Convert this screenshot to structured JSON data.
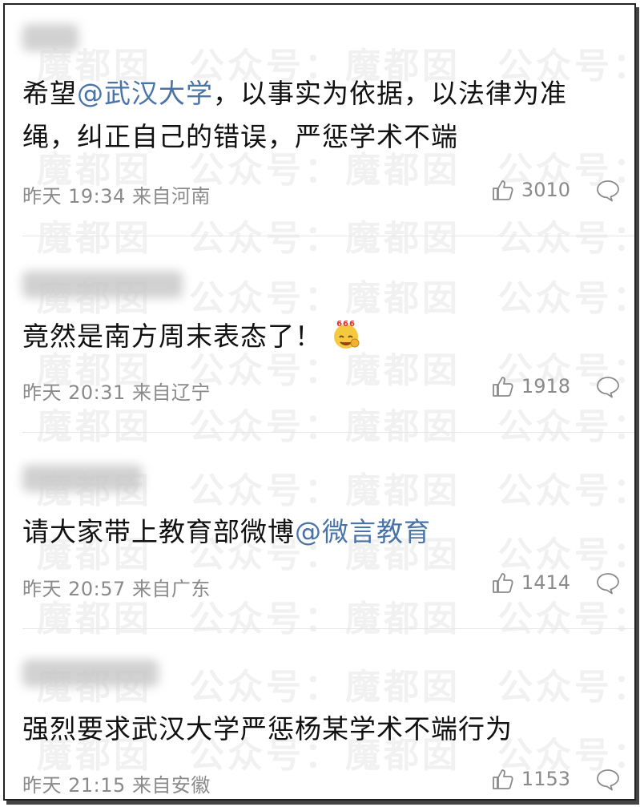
{
  "watermark": {
    "brand": "魔都囡",
    "account": "公众号："
  },
  "comments": [
    {
      "text_parts": [
        "希望",
        "@武汉大学",
        "，以事实为依据，以法律为准绳，纠正自己的错误，严惩学术不端"
      ],
      "time": "昨天 19:34",
      "location": "来自河南",
      "likes": "3010"
    },
    {
      "text_parts": [
        "竟然是南方周末表态了！"
      ],
      "emoji": "666",
      "time": "昨天 20:31",
      "location": "来自辽宁",
      "likes": "1918"
    },
    {
      "text_parts": [
        "请大家带上教育部微博",
        "@微言教育"
      ],
      "time": "昨天 20:57",
      "location": "来自广东",
      "likes": "1414"
    },
    {
      "text_parts": [
        "强烈要求武汉大学严惩杨某学术不端行为"
      ],
      "time": "昨天 21:15",
      "location": "来自安徽",
      "likes": "1153"
    }
  ],
  "colors": {
    "mention": "#4a73a8",
    "meta": "#8a8a8a",
    "text": "#111111"
  }
}
